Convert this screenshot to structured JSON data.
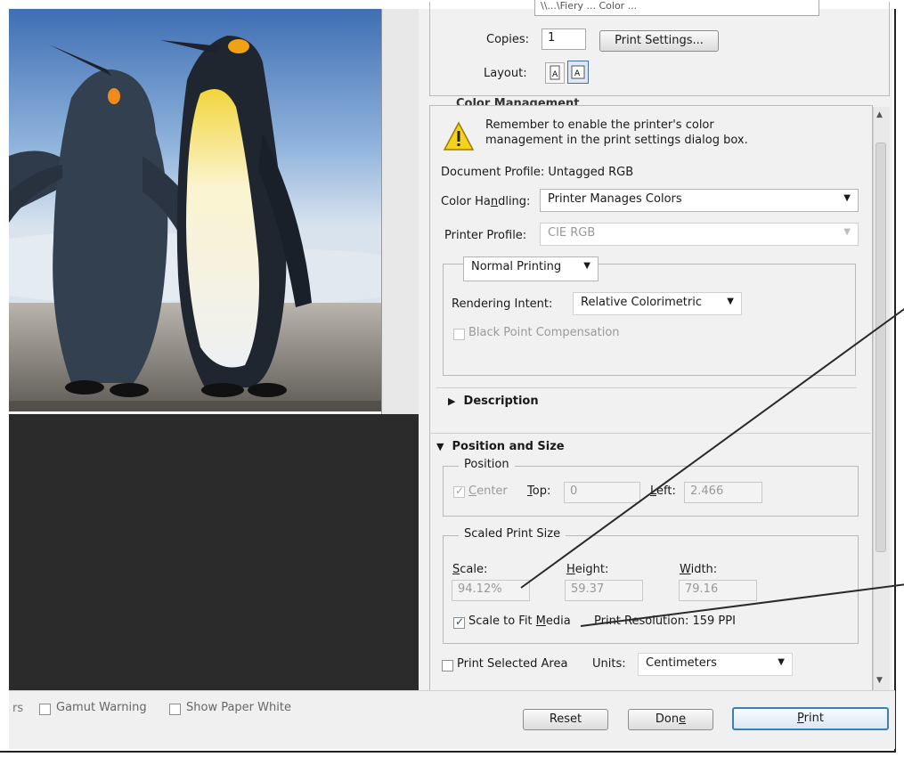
{
  "print_settings": {
    "printer_partial": "\\\\...\\Fiery ... Color ...",
    "copies_label": "Copies:",
    "copies_value": "1",
    "print_settings_button": "Print Settings...",
    "layout_label": "Layout:"
  },
  "color_management": {
    "section_title": "Color Management",
    "warning_line1": "Remember to enable the printer's color",
    "warning_line2": "management in the print settings dialog box.",
    "document_profile": "Document Profile: Untagged RGB",
    "color_handling_label_pre": "Color Ha",
    "color_handling_label_u": "n",
    "color_handling_label_post": "dling:",
    "color_handling_value": "Printer Manages Colors",
    "printer_profile_label": "Printer Profile:",
    "printer_profile_value": "CIE RGB",
    "normal_printing": "Normal Printing",
    "rendering_intent_label": "Rendering Intent:",
    "rendering_intent_value": "Relative Colorimetric",
    "black_point": "Black Point Compensation"
  },
  "description": {
    "title": "Description"
  },
  "position_size": {
    "title": "Position and Size",
    "position_group": "Position",
    "center_u": "C",
    "center_rest": "enter",
    "top_u": "T",
    "top_rest": "op:",
    "top_value": "0",
    "left_u": "L",
    "left_rest": "eft:",
    "left_value": "2.466",
    "scaled_group": "Scaled Print Size",
    "scale_u": "S",
    "scale_rest": "cale:",
    "height_u": "H",
    "height_rest": "eight:",
    "width_u": "W",
    "width_rest": "idth:",
    "scale_value": "94.12%",
    "height_value": "59.37",
    "width_value": "79.16",
    "scale_to_fit_pre": "Scale to Fit ",
    "scale_to_fit_u": "M",
    "scale_to_fit_post": "edia",
    "print_resolution": "Print Resolution: 159 PPI",
    "print_selected_area": "Print Selected Area",
    "units_label": "Units:",
    "units_value": "Centimeters"
  },
  "bottom": {
    "rs_partial": "rs",
    "gamut_warning": "Gamut Warning",
    "show_paper_white": "Show Paper White",
    "reset": "Reset",
    "done_pre": "Don",
    "done_u": "e",
    "print_u": "P",
    "print_rest": "rint"
  },
  "colors": {
    "panel_bg": "#f1f1f1",
    "preview_dark": "#2b2b2b",
    "accent_focus": "#3c7fb1"
  }
}
